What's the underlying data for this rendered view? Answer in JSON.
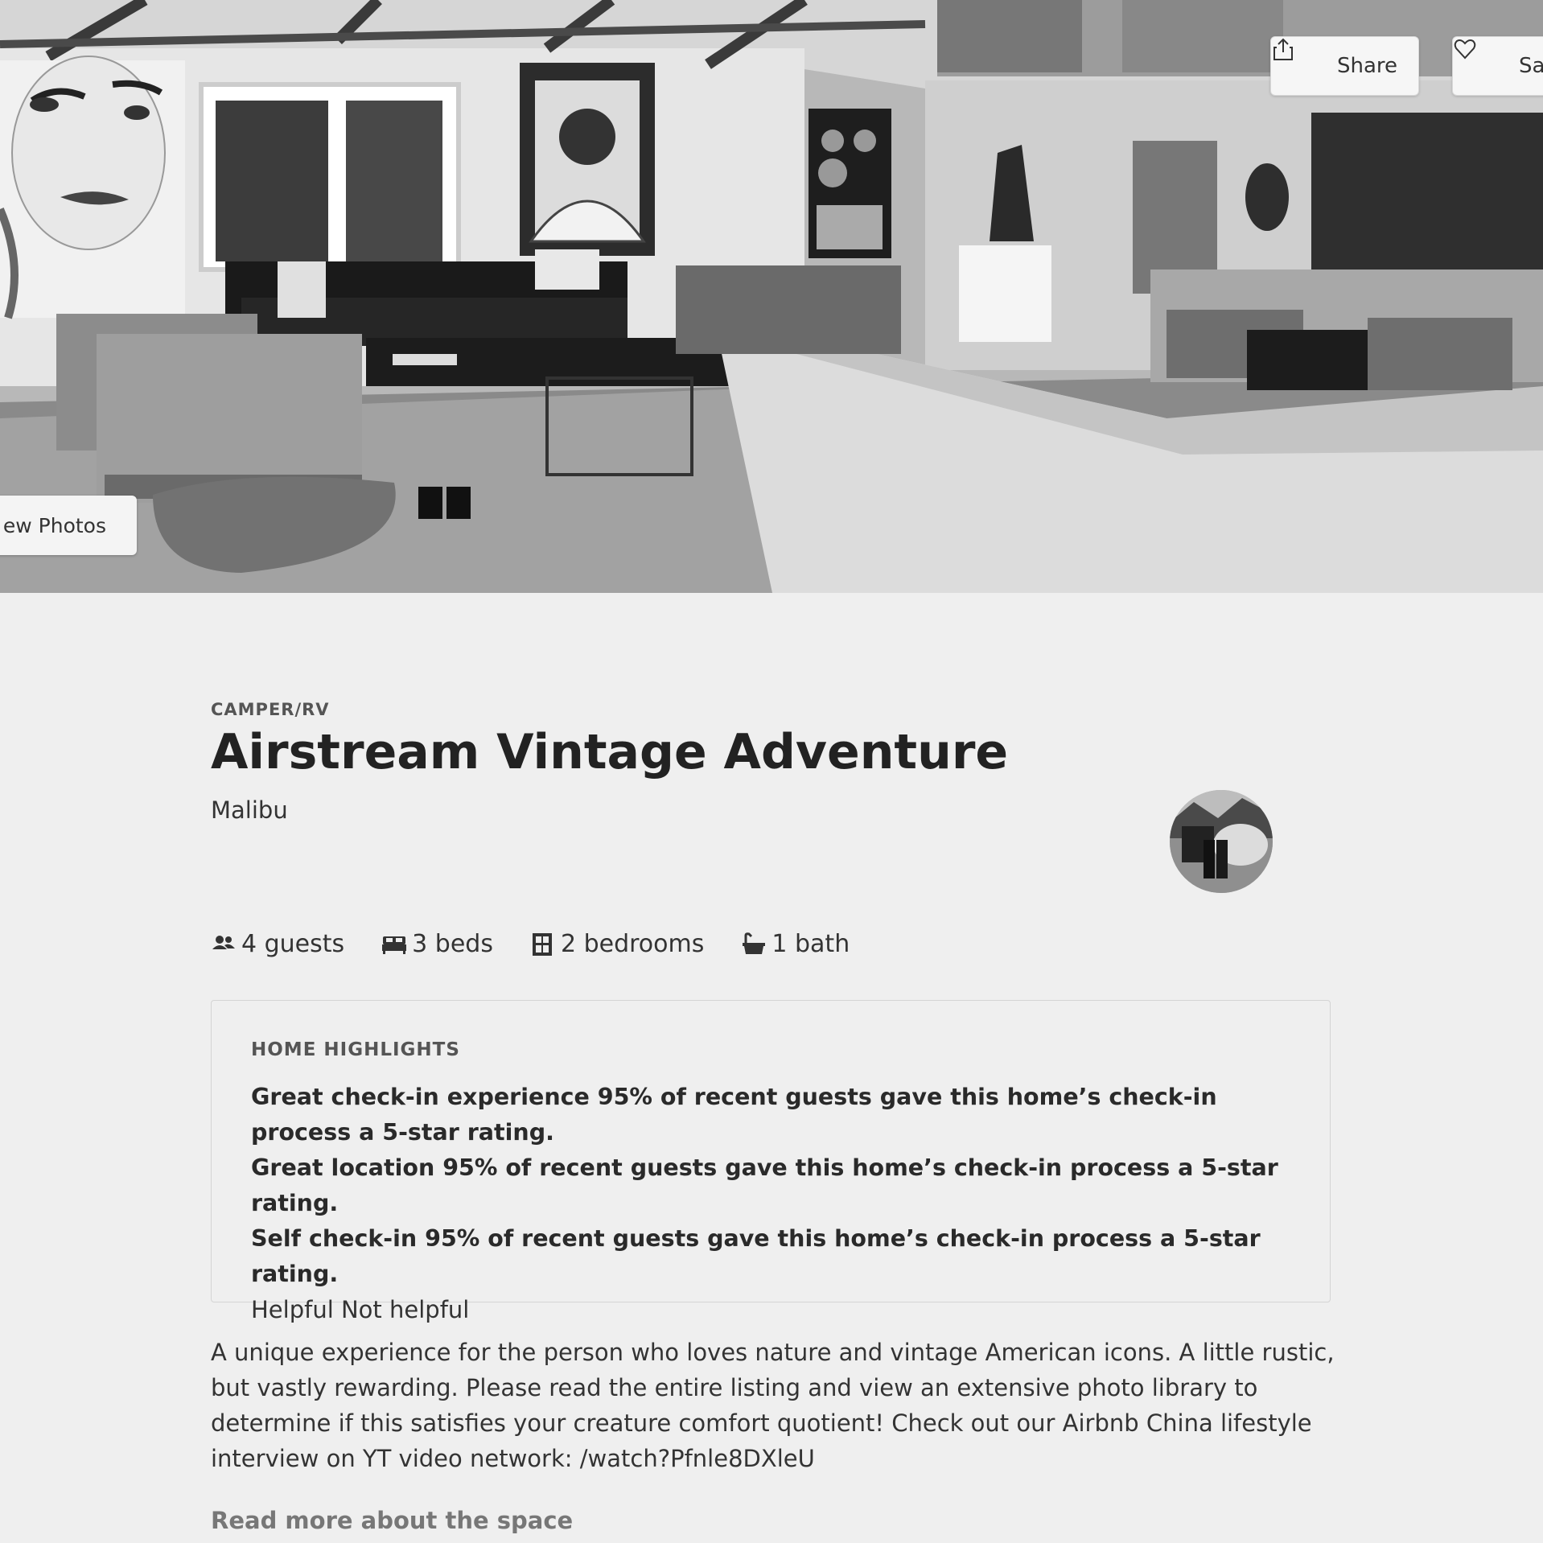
{
  "hero": {
    "share_label": "Share",
    "save_label": "Sav",
    "view_photos_label": "ew Photos"
  },
  "listing": {
    "category": "CAMPER/RV",
    "title": "Airstream Vintage Adventure",
    "location": "Malibu"
  },
  "stats": [
    {
      "icon": "guests-icon",
      "label": "4 guests"
    },
    {
      "icon": "bed-icon",
      "label": "3 beds"
    },
    {
      "icon": "bedroom-icon",
      "label": "2 bedrooms"
    },
    {
      "icon": "bath-icon",
      "label": "1 bath"
    }
  ],
  "highlights": {
    "heading": "HOME HIGHLIGHTS",
    "items": [
      "Great check-in experience 95% of recent guests gave this home’s check-in process a 5-star rating.",
      "Great location 95% of recent guests gave this home’s check-in process a 5-star rating.",
      "Self check-in 95% of recent guests gave this home’s check-in process a 5-star rating."
    ],
    "feedback": "Helpful Not helpful"
  },
  "description": "A unique experience for the person who loves nature and vintage American icons. A little rustic, but vastly rewarding. Please read the entire listing and view an extensive photo library to determine if this satisfies your creature comfort quotient! Check out our Airbnb China lifestyle interview on YT video network: /watch?Pfnle8DXleU",
  "read_more_label": "Read more about the space"
}
